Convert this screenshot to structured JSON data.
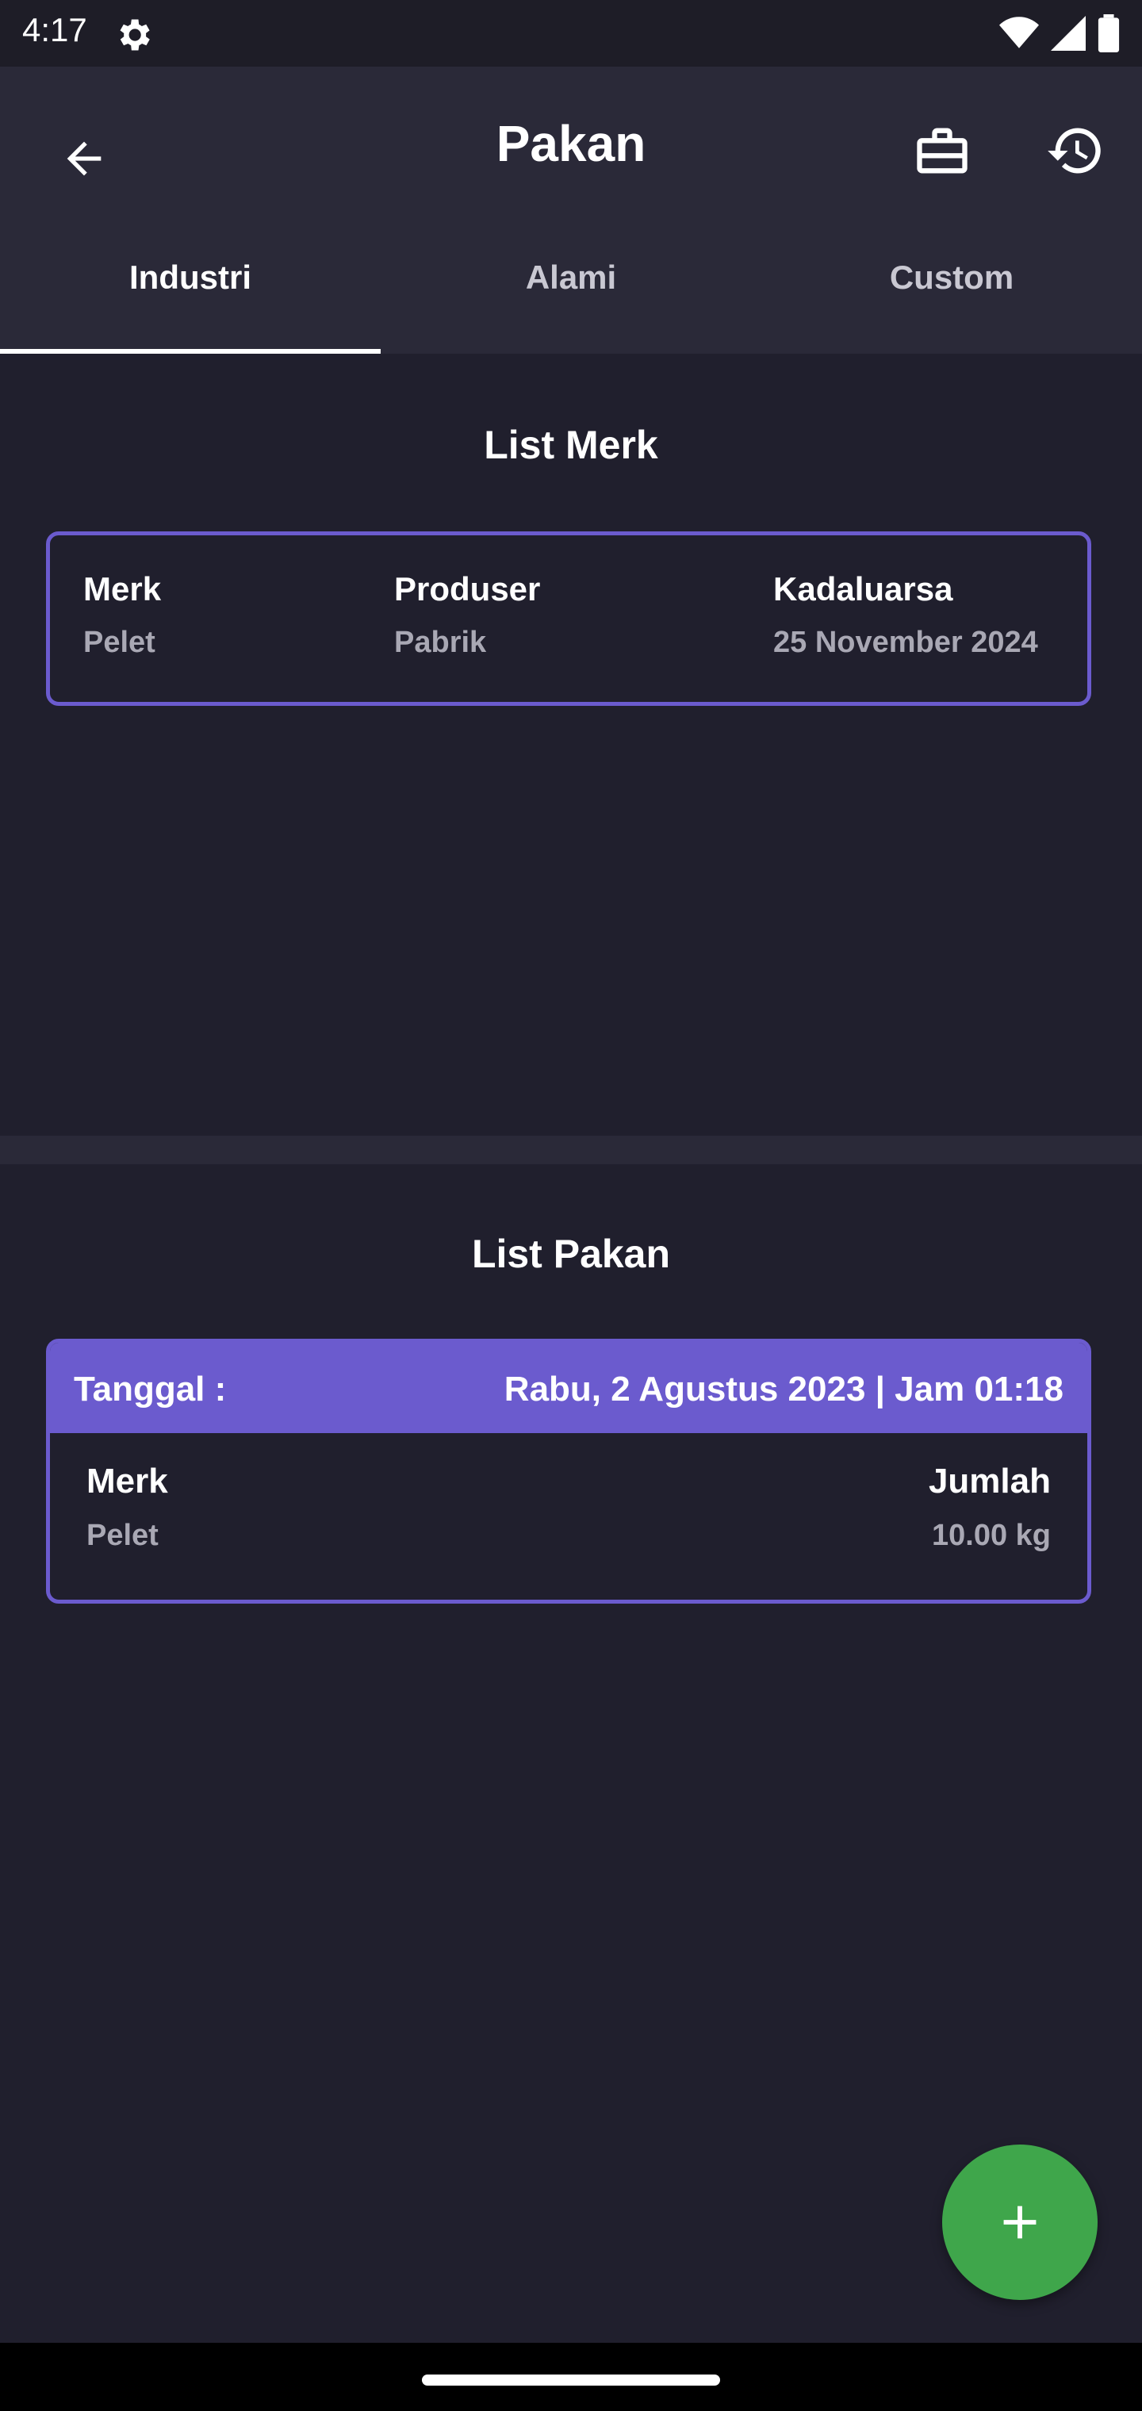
{
  "status_bar": {
    "time": "4:17"
  },
  "app_bar": {
    "title": "Pakan"
  },
  "tabs": [
    {
      "label": "Industri",
      "active": true
    },
    {
      "label": "Alami",
      "active": false
    },
    {
      "label": "Custom",
      "active": false
    }
  ],
  "list_merk": {
    "title": "List Merk",
    "item": {
      "merk_label": "Merk",
      "merk_value": "Pelet",
      "produser_label": "Produser",
      "produser_value": "Pabrik",
      "kadaluarsa_label": "Kadaluarsa",
      "kadaluarsa_value": "25 November 2024"
    }
  },
  "list_pakan": {
    "title": "List Pakan",
    "item": {
      "tanggal_label": "Tanggal :",
      "tanggal_value": "Rabu, 2 Agustus 2023 | Jam 01:18",
      "merk_label": "Merk",
      "merk_value": "Pelet",
      "jumlah_label": "Jumlah",
      "jumlah_value": "10.00 kg"
    }
  },
  "icons": [
    "settings-icon",
    "wifi-icon",
    "signal-icon",
    "battery-icon",
    "back-arrow-icon",
    "briefcase-icon",
    "history-icon",
    "plus-icon"
  ],
  "colors": {
    "accent": "#6b5bce",
    "fab": "#3fa64b",
    "background": "#201f2d",
    "appbar": "#2a2938"
  }
}
